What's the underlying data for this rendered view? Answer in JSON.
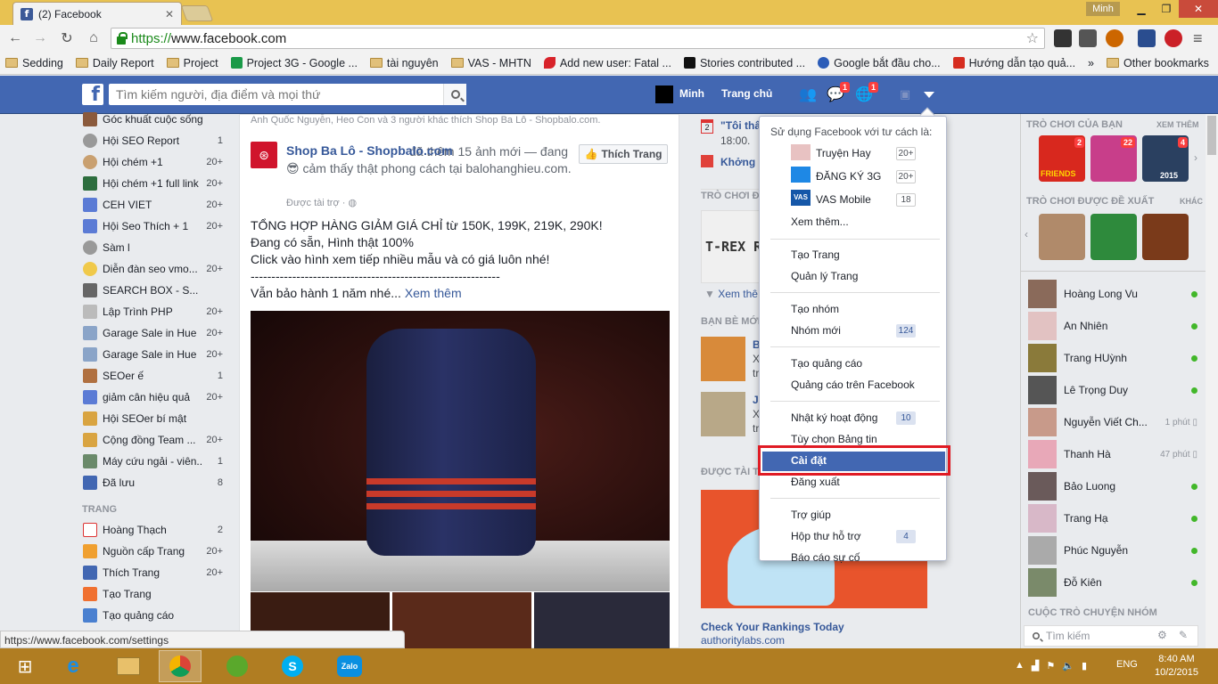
{
  "browser": {
    "tab_title": "(2) Facebook",
    "user": "Minh",
    "url_scheme": "https://",
    "url_host": "www.facebook.com",
    "status_url": "https://www.facebook.com/settings"
  },
  "bookmarks": [
    {
      "label": "Sedding",
      "icon": "folder"
    },
    {
      "label": "Daily Report",
      "icon": "folder"
    },
    {
      "label": "Project",
      "icon": "folder"
    },
    {
      "label": "Project 3G - Google ...",
      "icon": "sheets"
    },
    {
      "label": "tài nguyên",
      "icon": "folder"
    },
    {
      "label": "VAS - MHTN",
      "icon": "folder"
    },
    {
      "label": "Add new user: Fatal ...",
      "icon": "bird"
    },
    {
      "label": "Stories contributed ...",
      "icon": "black"
    },
    {
      "label": "Google bắt đầu cho...",
      "icon": "gear"
    },
    {
      "label": "Hướng dẫn tạo quả...",
      "icon": "red"
    }
  ],
  "other_bookmarks": "Other bookmarks",
  "fb": {
    "search_placeholder": "Tìm kiếm người, địa điểm và mọi thứ",
    "user_name": "Minh",
    "home": "Trang chủ",
    "msg_badge": "1",
    "notif_badge": "1"
  },
  "left_groups": [
    {
      "label": "Góc khuất cuộc sống",
      "count": ""
    },
    {
      "label": "Hội SEO Report",
      "count": "1"
    },
    {
      "label": "Hội chém +1",
      "count": "20+"
    },
    {
      "label": "Hội chém +1 full link",
      "count": "20+"
    },
    {
      "label": "CEH VIET",
      "count": "20+"
    },
    {
      "label": "Hội Seo Thích + 1",
      "count": "20+"
    },
    {
      "label": "Sàm l",
      "count": ""
    },
    {
      "label": "Diễn đàn seo vmo...",
      "count": "20+"
    },
    {
      "label": "SEARCH BOX - S...",
      "count": ""
    },
    {
      "label": "Lập Trình PHP",
      "count": "20+"
    },
    {
      "label": "Garage Sale in Hue",
      "count": "20+"
    },
    {
      "label": "Garage Sale in Hue",
      "count": "20+"
    },
    {
      "label": "SEOer ế",
      "count": "1"
    },
    {
      "label": "giảm cân hiệu quả",
      "count": "20+"
    },
    {
      "label": "Hội SEOer bí mật",
      "count": ""
    },
    {
      "label": "Cộng đồng Team ...",
      "count": "20+"
    },
    {
      "label": "Máy cứu ngải - viên...",
      "count": "1"
    },
    {
      "label": "Đã lưu",
      "count": "8"
    }
  ],
  "trang_header": "TRANG",
  "left_pages": [
    {
      "label": "Hoàng Thạch",
      "count": "2"
    },
    {
      "label": "Nguồn cấp Trang",
      "count": "20+"
    },
    {
      "label": "Thích Trang",
      "count": "20+"
    },
    {
      "label": "Tạo Trang",
      "count": ""
    },
    {
      "label": "Tạo quảng cáo",
      "count": ""
    }
  ],
  "post": {
    "context": "Anh Quốc Nguyễn, Heo Con và 3 người khác thích Shop Ba Lô - Shopbalo.com.",
    "page_name": "Shop Ba Lô - Shopbalo.com",
    "meta": "đã thêm 15 ảnh mới — đang 😎 cảm thấy thật phong cách tại balohanghieu.com.",
    "sponsored": "Được tài trợ · ◍",
    "like_button": "Thích Trang",
    "line1": "TỔNG HỢP HÀNG GIẢM GIÁ CHỈ từ 150K, 199K, 219K, 290K!",
    "line2": "Đang có sẵn, Hình thật 100%",
    "line3": "Click vào hình xem tiếp nhiều mẫu và có giá luôn nhé!",
    "line4": "------------------------------------------------------------",
    "line5": "Vẫn bảo hành 1 năm nhé...",
    "see_more": "Xem thêm"
  },
  "right": {
    "event_day": "2",
    "event_title": "\"Tôi thấ",
    "event_time": "18:00.",
    "event2": "Khởng C",
    "games_header": "TRÒ CHƠI Đ",
    "game_text": "T-REX RUNN",
    "see_more": "Xem thê",
    "friends_header": "BẠN BÈ MỚI",
    "friend1_initial": "B",
    "friend1_sub1": "X",
    "friend1_sub2": "tr",
    "friend2_initial": "J",
    "friend2_sub1": "X",
    "friend2_sub2": "tr",
    "sponsored_header": "ĐƯỢC TÀI T",
    "ad_title": "Check Your Rankings Today",
    "ad_url": "authoritylabs.com"
  },
  "dropdown": {
    "use_as": "Sử dụng Facebook với tư cách là:",
    "pages": [
      {
        "label": "Truyện Hay",
        "count": "20+"
      },
      {
        "label": "ĐĂNG KÝ 3G",
        "count": "20+"
      },
      {
        "label": "VAS Mobile",
        "count": "18"
      }
    ],
    "see_more": "Xem thêm...",
    "create_page": "Tạo Trang",
    "manage_pages": "Quản lý Trang",
    "create_group": "Tạo nhóm",
    "new_groups": "Nhóm mới",
    "new_groups_count": "124",
    "create_ad": "Tạo quảng cáo",
    "ads_on_fb": "Quảng cáo trên Facebook",
    "activity_log": "Nhật ký hoạt động",
    "activity_count": "10",
    "news_prefs": "Tùy chọn Bảng tin",
    "settings": "Cài đặt",
    "logout": "Đăng xuất",
    "help": "Trợ giúp",
    "support_inbox": "Hộp thư hỗ trợ",
    "support_count": "4",
    "report": "Báo cáo sự cố"
  },
  "chat": {
    "your_games": "TRÒ CHƠI CỦA BẠN",
    "see_all": "XEM THÊM",
    "suggested_games": "TRÒ CHƠI ĐƯỢC ĐỀ XUẤT",
    "other": "KHÁC",
    "game_badges": [
      "2",
      "22",
      "4"
    ],
    "game_labels": [
      "FRIENDS",
      "",
      "2015"
    ],
    "friends": [
      {
        "name": "Hoàng Long Vu",
        "time": "",
        "status": "online"
      },
      {
        "name": "An Nhiên",
        "time": "",
        "status": "online"
      },
      {
        "name": "Trang HUỳnh",
        "time": "",
        "status": "online"
      },
      {
        "name": "Lê Trọng Duy",
        "time": "",
        "status": "online"
      },
      {
        "name": "Nguyễn Viết Ch...",
        "time": "1 phút",
        "status": "mobile"
      },
      {
        "name": "Thanh Hà",
        "time": "47 phút",
        "status": "mobile"
      },
      {
        "name": "Bảo Luong",
        "time": "",
        "status": "online"
      },
      {
        "name": "Trang Hạ",
        "time": "",
        "status": "online"
      },
      {
        "name": "Phúc Nguyễn",
        "time": "",
        "status": "online"
      },
      {
        "name": "Đỗ Kiên",
        "time": "",
        "status": "online"
      }
    ],
    "group_chats": "CUỘC TRÒ CHUYỆN NHÓM",
    "search_placeholder": "Tìm kiếm"
  },
  "taskbar": {
    "lang": "ENG",
    "time": "8:40 AM",
    "date": "10/2/2015",
    "zalo": "Zalo"
  },
  "colors": {
    "fb_blue": "#4267b2",
    "highlight_frame": "#e01b24",
    "taskbar": "#b07d22",
    "titlebar": "#e8c252"
  }
}
